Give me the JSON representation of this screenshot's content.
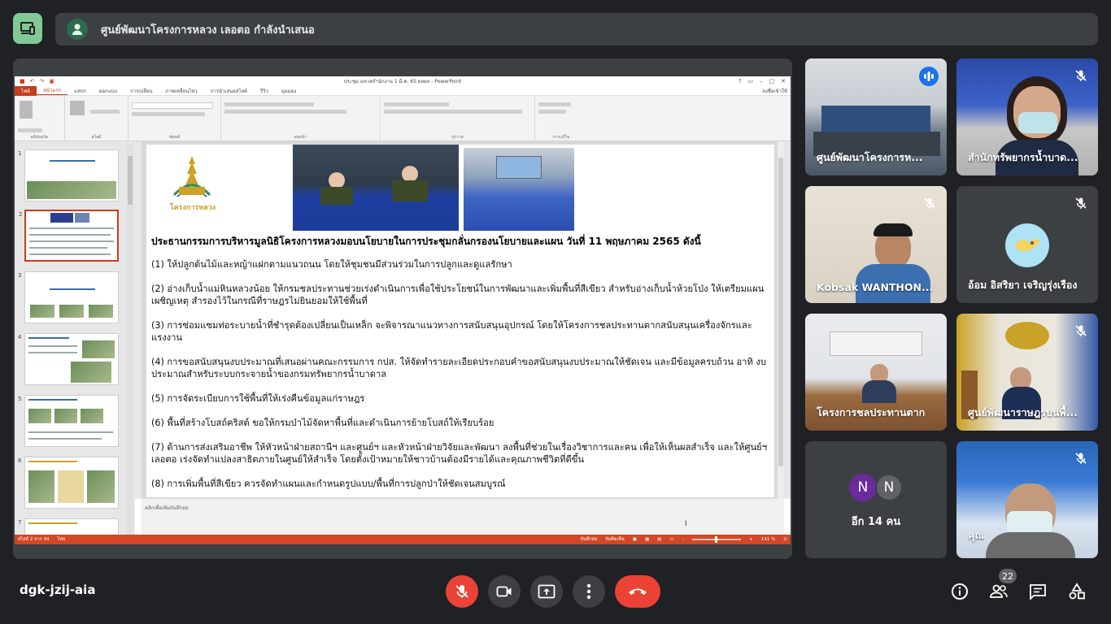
{
  "header": {
    "presentation_banner": "ศูนย์พัฒนาโครงการหลวง เลอตอ กำลังนำเสนอ"
  },
  "presentation": {
    "window_title": "ประชุม มหาสถำนักงาน 1 มี.ค. 65 ผลผล - PowerPoint",
    "menu_tabs": [
      "ไฟล์",
      "หน้าแรก",
      "แทรก",
      "ออกแบบ",
      "การเปลี่ยน",
      "ภาพเคลื่อนไหว",
      "การนำเสนอสไลด์",
      "รีวิว",
      "มุมมอง"
    ],
    "active_tab": "หน้าแรก",
    "user": "ลงชื่อเข้าใช้",
    "ribbon_groups": [
      "คลิปบอร์ด",
      "สไลด์",
      "ฟอนต์",
      "ย่อหน้า",
      "รูปวาด",
      "การแก้ไข"
    ],
    "slide_numbers": [
      "1",
      "2",
      "3",
      "4",
      "5",
      "6",
      "7"
    ],
    "selected_slide": 2,
    "slide": {
      "logo_text": "โครงการหลวง",
      "heading": "ประธานกรรมการบริหารมูลนิธิโครงการหลวงมอบนโยบายในการประชุมกลั่นกรองนโยบายและแผน วันที่  11 พฤษภาคม 2565  ดังนี้",
      "items": [
        "(1) ให้ปลูกต้นไม้และหญ้าแฝกตามแนวถนน โดยให้ชุมชนมีส่วนร่วมในการปลูกและดูแลรักษา",
        "(2) อ่างเก็บน้ำแม่หินหลวงน้อย ให้กรมชลประทานช่วยเร่งดำเนินการเพื่อใช้ประโยชน์ในการพัฒนาและเพิ่มพื้นที่สีเขียว สำหรับอ่างเก็บน้ำห้วยโป่ง ให้เตรียมแผนเผชิญเหตุ สำรองไว้ในกรณีที่ราษฎรไม่ยินยอมให้ใช้พื้นที่",
        "(3) การซ่อมแซมท่อระบายน้ำที่ชำรุดต้องเปลี่ยนเป็นเหล็ก จะพิจารณาแนวทางการสนับสนุนอุปกรณ์ โดยให้โครงการชลประทานตากสนับสนุนเครื่องจักรและแรงงาน",
        "(4) การขอสนับสนุนงบประมาณที่เสนอผ่านคณะกรรมการ กปส. ให้จัดทำรายละเอียดประกอบคำขอสนับสนุนงบประมาณให้ชัดเจน และมีข้อมูลครบถ้วน อาทิ งบประมาณสำหรับระบบกระจายน้ำของกรมทรัพยากรน้ำบาดาล",
        "(5) การจัดระเบียบการใช้พื้นที่ให้เร่งคืนข้อมูลแก่ราษฎร",
        "(6) พื้นที่สร้างโบสถ์คริสต์ ขอให้กรมป่าไม้จัดหาพื้นที่และดำเนินการย้ายโบสถ์ให้เรียบร้อย",
        "(7) ด้านการส่งเสริมอาชีพ ให้หัวหน้าฝ่ายสถานีฯ และศูนย์ฯ และหัวหน้าฝ่ายวิจัยและพัฒนา  ลงพื้นที่ช่วยในเรื่องวิชาการและคน เพื่อให้เห็นผลสำเร็จ และให้ศูนย์ฯเลอตอ เร่งจัดทำแปลงสาธิตภายในศูนย์ให้สำเร็จ โดยตั้งเป้าหมายให้ชาวบ้านต้องมีรายได้และคุณภาพชีวิตที่ดีขึ้น",
        "(8) การเพิ่มพื้นที่สีเขียว ควรจัดทำแผนและกำหนดรูปแบบ/พื้นที่การปลูกป่าให้ชัดเจนสมบูรณ์"
      ]
    },
    "notes_placeholder": "คลิกเพื่อเพิ่มบันทึกย่อ",
    "status_left": "สไลด์ 2 จาก 34",
    "status_lang": "ไทย",
    "status_notes": "บันทึกย่อ",
    "status_comments": "ข้อคิดเห็น",
    "zoom": "141 %"
  },
  "participants": [
    {
      "name": "ศูนย์พัฒนาโครงการห...",
      "muted": false,
      "speaking": true
    },
    {
      "name": "สำนักทรัพยากรน้ำบาด...",
      "muted": true,
      "speaking": false
    },
    {
      "name": "Kobsak WANTHON...",
      "muted": true,
      "speaking": false
    },
    {
      "name": "อ้อม อิสริยา เจริญรุ่งเรือง",
      "muted": true,
      "speaking": false
    },
    {
      "name": "โครงการชลประทานตาก",
      "muted": false,
      "speaking": false
    },
    {
      "name": "ศูนย์พัฒนาราษฎรบนพื้...",
      "muted": true,
      "speaking": false
    },
    {
      "name": "อีก 14 คน",
      "avatars": [
        "N",
        "N"
      ]
    },
    {
      "name": "คุณ",
      "muted": true,
      "speaking": false
    }
  ],
  "bottom_bar": {
    "meeting_code": "dgk-jzij-aia",
    "people_count": "22"
  },
  "colors": {
    "background": "#202124",
    "tile": "#3c4043",
    "danger": "#ea4335",
    "active_border": "#8ab4f8",
    "ppt_accent": "#c43e1c"
  }
}
